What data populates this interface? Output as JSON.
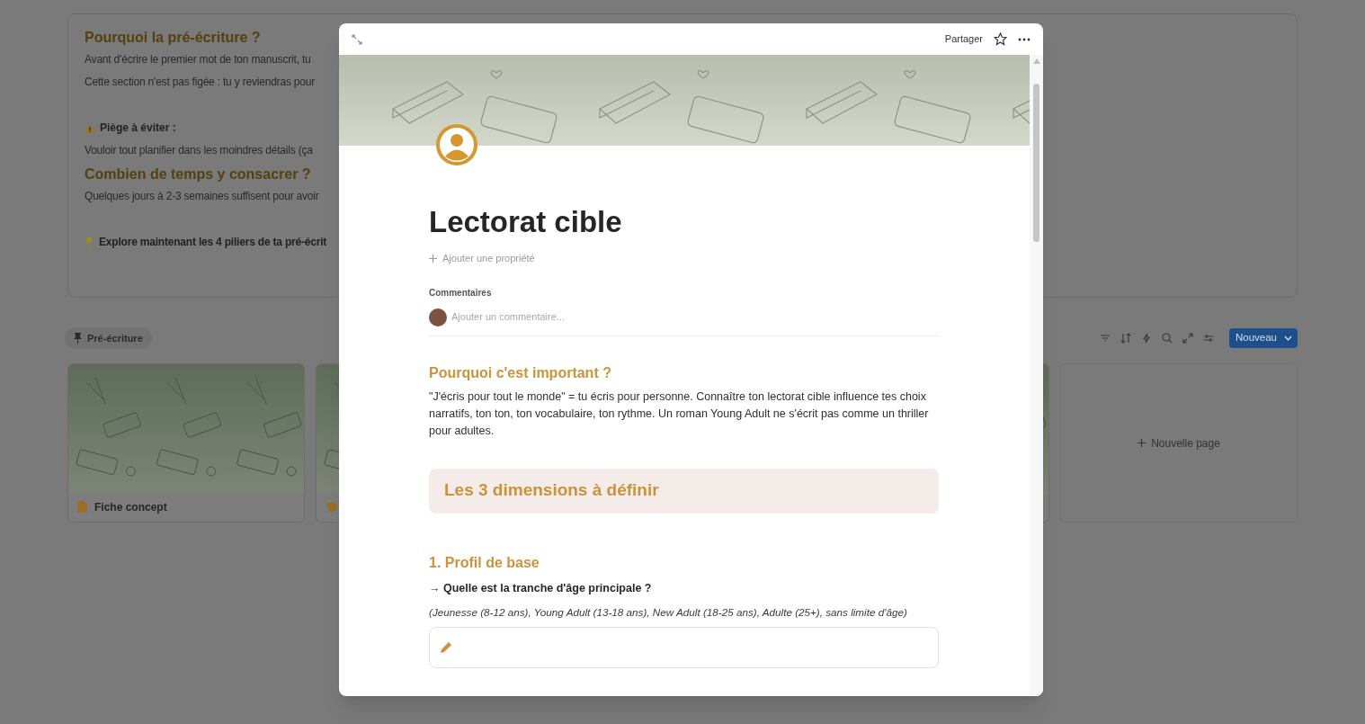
{
  "background": {
    "intro": [
      {
        "kind": "heading",
        "text": "Pourquoi la pré-écriture ?"
      },
      {
        "kind": "paragraph",
        "text": "Avant d'écrire le premier mot de ton manuscrit, tu"
      },
      {
        "kind": "paragraph",
        "text": "Cette section n'est pas figée : tu y reviendras pour"
      },
      {
        "kind": "warning",
        "text": "Piège à éviter :"
      },
      {
        "kind": "paragraph",
        "text": "Vouloir tout planifier dans les moindres détails (ça"
      },
      {
        "kind": "heading",
        "text": "Combien de temps y consacrer ?"
      },
      {
        "kind": "paragraph",
        "text": "Quelques jours à 2-3 semaines suffisent pour avoir"
      },
      {
        "kind": "pointer",
        "text": "Explore maintenant les 4 piliers de ta pré-écrit"
      }
    ],
    "view_tab": "Pré-écriture",
    "new_button": "Nouveau",
    "cards": [
      {
        "kind": "page",
        "title": "Fiche concept"
      },
      {
        "kind": "idea"
      },
      {
        "kind": "cover"
      }
    ],
    "new_page": "Nouvelle page"
  },
  "dialog": {
    "share": "Partager",
    "title": "Lectorat cible",
    "add_property": "Ajouter une propriété",
    "comments": {
      "label": "Commentaires",
      "placeholder": "Ajouter un commentaire..."
    },
    "blocks": [
      {
        "kind": "heading",
        "text": "Pourquoi c'est important ?"
      },
      {
        "kind": "paragraph",
        "text": "\"J'écris pour tout le monde\" = tu écris pour personne. Connaître ton lectorat cible influence tes choix narratifs, ton ton, ton vocabulaire, ton rythme. Un roman Young Adult ne s'écrit pas comme un thriller pour adultes."
      },
      {
        "kind": "callout",
        "text": "Les 3 dimensions à définir"
      },
      {
        "kind": "heading",
        "text": "1. Profil de base"
      },
      {
        "kind": "question",
        "text": "→ Quelle est la tranche d'âge principale ?"
      },
      {
        "kind": "hint",
        "text": "(Jeunesse (8-12 ans), Young Adult (13-18 ans), New Adult (18-25 ans), Adulte (25+), sans limite d'âge)"
      },
      {
        "kind": "answer"
      }
    ]
  }
}
